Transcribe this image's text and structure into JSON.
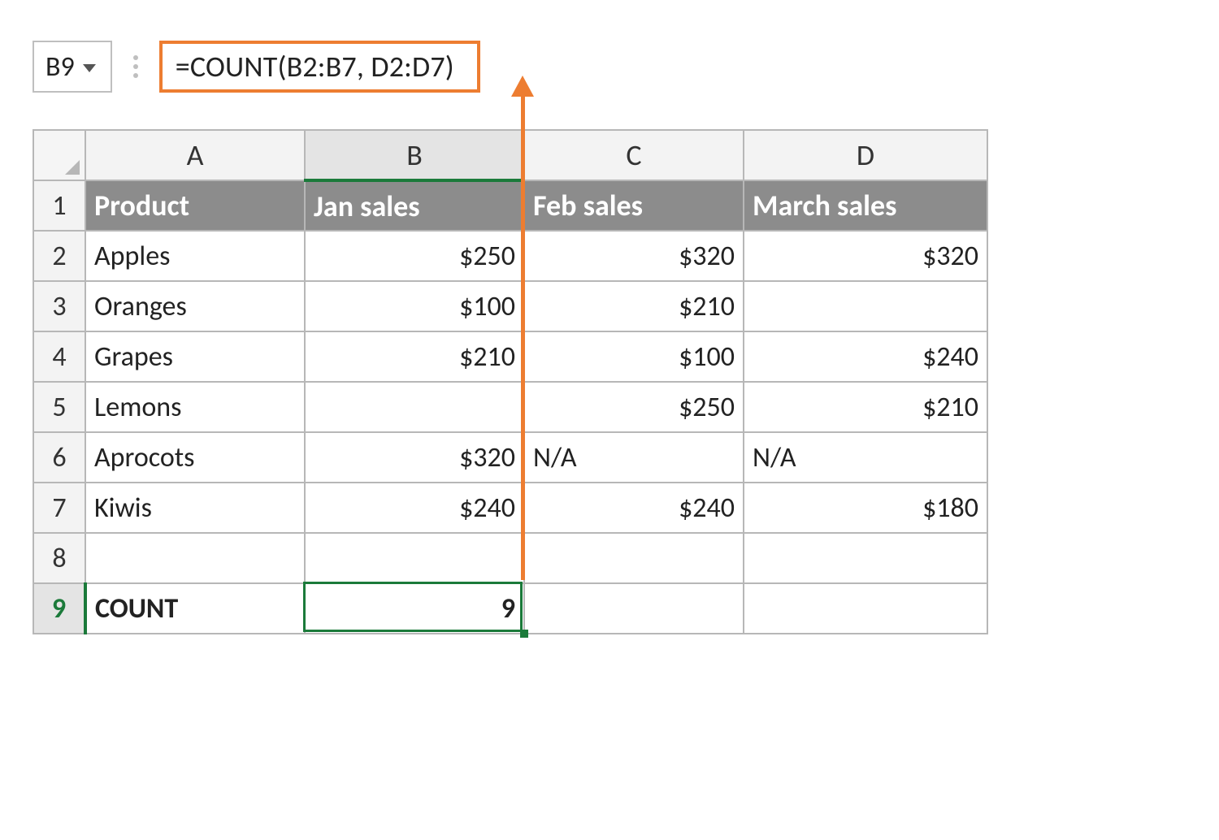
{
  "name_box": {
    "value": "B9"
  },
  "formula_bar": {
    "value": "=COUNT(B2:B7, D2:D7)"
  },
  "columns": [
    "A",
    "B",
    "C",
    "D"
  ],
  "rows": [
    "1",
    "2",
    "3",
    "4",
    "5",
    "6",
    "7",
    "8",
    "9"
  ],
  "headers": {
    "A": "Product",
    "B": "Jan sales",
    "C": "Feb sales",
    "D": "March sales"
  },
  "r2": {
    "A": "Apples",
    "B": "$250",
    "C": "$320",
    "D": "$320"
  },
  "r3": {
    "A": "Oranges",
    "B": "$100",
    "C": "$210",
    "D": ""
  },
  "r4": {
    "A": "Grapes",
    "B": "$210",
    "C": "$100",
    "D": "$240"
  },
  "r5": {
    "A": "Lemons",
    "B": "",
    "C": "$250",
    "D": "$210"
  },
  "r6": {
    "A": "Aprocots",
    "B": "$320",
    "C": "N/A",
    "D": "N/A"
  },
  "r7": {
    "A": "Kiwis",
    "B": "$240",
    "C": "$240",
    "D": "$180"
  },
  "r8": {
    "A": "",
    "B": "",
    "C": "",
    "D": ""
  },
  "r9": {
    "A": "COUNT",
    "B": "9",
    "C": "",
    "D": ""
  },
  "selected_col": "B",
  "selected_row": "9"
}
